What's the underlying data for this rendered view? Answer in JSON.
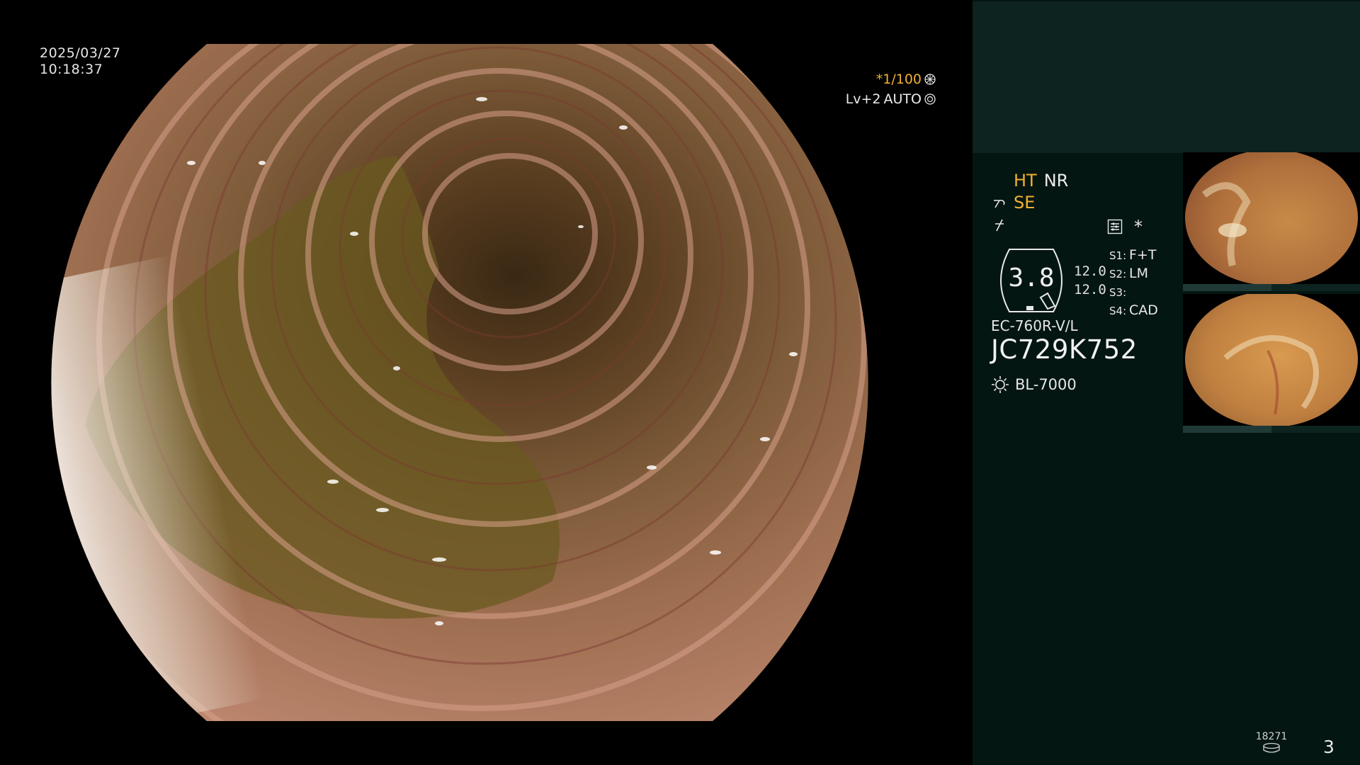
{
  "overlay": {
    "date": "2025/03/27",
    "time": "10:18:37",
    "shutter": "*1/100",
    "brightness": "Lv+2",
    "iris": "AUTO"
  },
  "side": {
    "mode_ht": "HT",
    "mode_nr": "NR",
    "mode_se": "SE",
    "asterisk": "*",
    "zoom_value": "3.8",
    "value_1": "12.0",
    "value_2": "12.0",
    "s1_key": "S1:",
    "s1_val": "F+T",
    "s2_key": "S2:",
    "s2_val": "LM",
    "s3_key": "S3:",
    "s3_val": "",
    "s4_key": "S4:",
    "s4_val": "CAD",
    "scope_model": "EC-760R-V/L",
    "scope_serial": "JC729K752",
    "light_source": "BL-7000",
    "capture_count": "18271",
    "page_number": "3"
  },
  "icons": {
    "shutter": "aperture-icon",
    "iris": "iris-icon",
    "se_mode": "scope-tip-icon",
    "lightning": "lightning-icon",
    "menu": "settings-menu-icon",
    "light": "sun-icon",
    "storage": "storage-disk-icon"
  },
  "colors": {
    "accent_orange": "#f0b030",
    "panel_bg": "#041612",
    "panel_header_bg": "#0d2320"
  }
}
